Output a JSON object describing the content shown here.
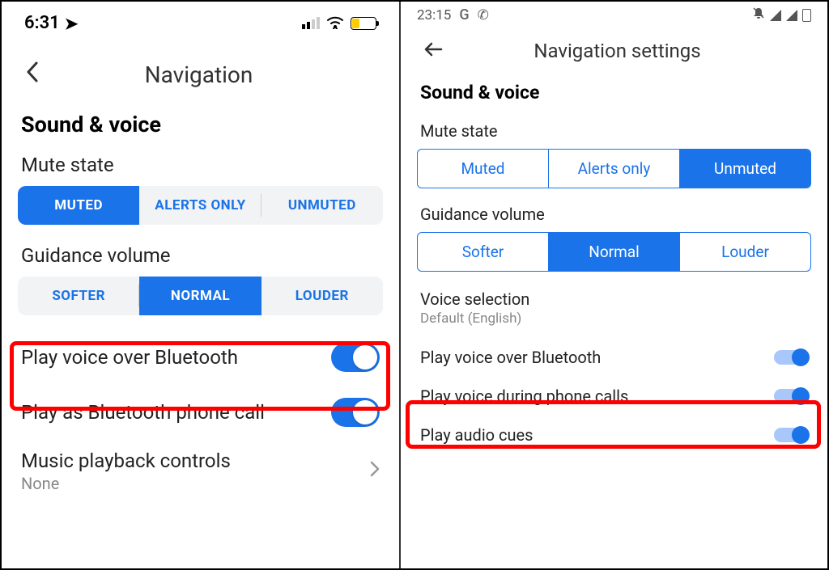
{
  "left": {
    "status": {
      "time": "6:31"
    },
    "title": "Navigation",
    "section": "Sound & voice",
    "mute": {
      "label": "Mute state",
      "options": [
        "MUTED",
        "ALERTS ONLY",
        "UNMUTED"
      ],
      "selected": "MUTED"
    },
    "volume": {
      "label": "Guidance volume",
      "options": [
        "SOFTER",
        "NORMAL",
        "LOUDER"
      ],
      "selected": "NORMAL"
    },
    "bt_voice": {
      "label": "Play voice over Bluetooth",
      "value": true
    },
    "bt_call": {
      "label": "Play as Bluetooth phone call",
      "value": true
    },
    "music": {
      "label": "Music playback controls",
      "value": "None"
    }
  },
  "right": {
    "status": {
      "time": "23:15"
    },
    "title": "Navigation settings",
    "section": "Sound & voice",
    "mute": {
      "label": "Mute state",
      "options": [
        "Muted",
        "Alerts only",
        "Unmuted"
      ],
      "selected": "Unmuted"
    },
    "volume": {
      "label": "Guidance volume",
      "options": [
        "Softer",
        "Normal",
        "Louder"
      ],
      "selected": "Normal"
    },
    "voice_sel": {
      "label": "Voice selection",
      "value": "Default (English)"
    },
    "bt_voice": {
      "label": "Play voice over Bluetooth",
      "value": true
    },
    "during_call": {
      "label": "Play voice during phone calls",
      "value": true
    },
    "audio_cues": {
      "label": "Play audio cues",
      "value": true
    }
  }
}
